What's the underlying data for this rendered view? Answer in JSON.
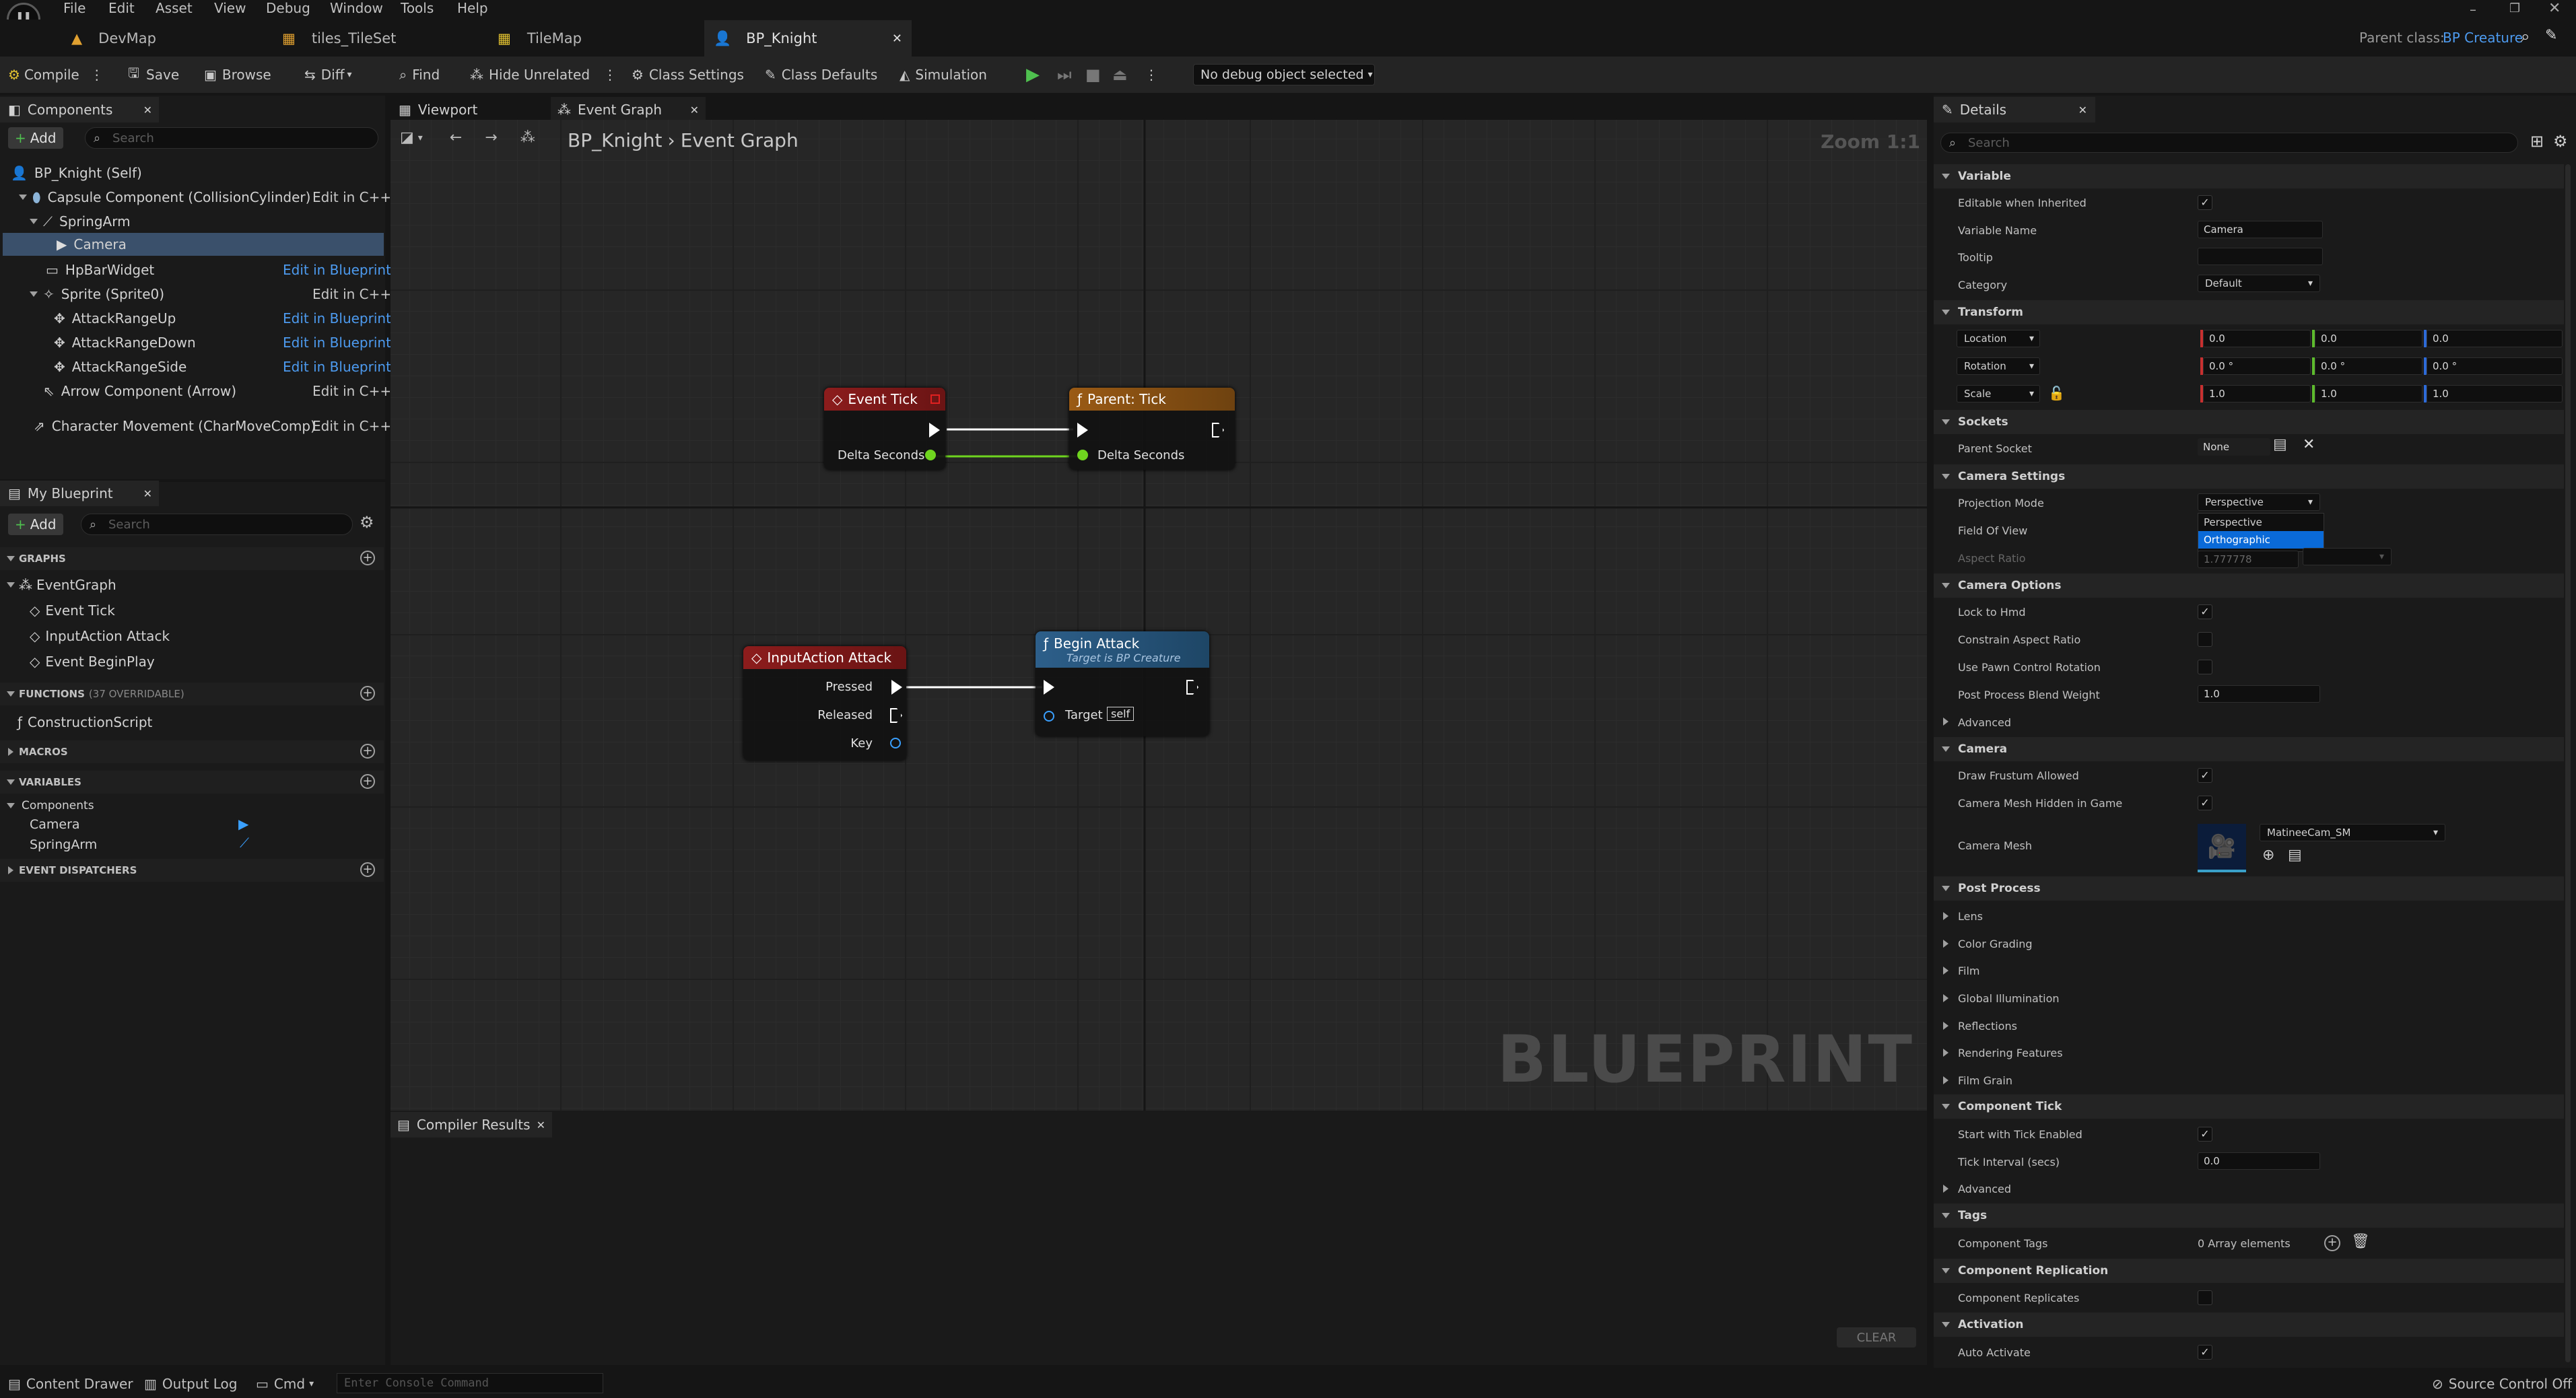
{
  "menu": [
    "File",
    "Edit",
    "Asset",
    "View",
    "Debug",
    "Window",
    "Tools",
    "Help"
  ],
  "logo": "U",
  "tabs": [
    {
      "label": "DevMap"
    },
    {
      "label": "tiles_TileSet"
    },
    {
      "label": "TileMap"
    },
    {
      "label": "BP_Knight"
    }
  ],
  "parent_class": {
    "label": "Parent class:",
    "value": "BP Creature"
  },
  "toolbar": {
    "compile": "Compile",
    "save": "Save",
    "browse": "Browse",
    "diff": "Diff",
    "find": "Find",
    "hide_unrelated": "Hide Unrelated",
    "class_settings": "Class Settings",
    "class_defaults": "Class Defaults",
    "simulation": "Simulation",
    "debug_object": "No debug object selected"
  },
  "components": {
    "tab": "Components",
    "add": "Add",
    "search_placeholder": "Search",
    "items": [
      {
        "label": "BP_Knight (Self)",
        "action": ""
      },
      {
        "label": "Capsule Component (CollisionCylinder)",
        "action": "Edit in C++"
      },
      {
        "label": "SpringArm",
        "action": ""
      },
      {
        "label": "Camera",
        "action": ""
      },
      {
        "label": "HpBarWidget",
        "action": "Edit in Blueprint"
      },
      {
        "label": "Sprite (Sprite0)",
        "action": "Edit in C++"
      },
      {
        "label": "AttackRangeUp",
        "action": "Edit in Blueprint"
      },
      {
        "label": "AttackRangeDown",
        "action": "Edit in Blueprint"
      },
      {
        "label": "AttackRangeSide",
        "action": "Edit in Blueprint"
      },
      {
        "label": "Arrow Component (Arrow)",
        "action": "Edit in C++"
      },
      {
        "label": "Character Movement (CharMoveComp)",
        "action": "Edit in C++"
      }
    ]
  },
  "my_blueprint": {
    "tab": "My Blueprint",
    "add": "Add",
    "search_placeholder": "Search",
    "graphs_header": "GRAPHS",
    "event_graph": "EventGraph",
    "events": [
      "Event Tick",
      "InputAction Attack",
      "Event BeginPlay"
    ],
    "functions_header": "FUNCTIONS",
    "functions_overridable": "(37 OVERRIDABLE)",
    "construction_script": "ConstructionScript",
    "macros_header": "MACROS",
    "variables_header": "VARIABLES",
    "components_category": "Components",
    "variables": [
      "Camera",
      "SpringArm"
    ],
    "dispatchers_header": "EVENT DISPATCHERS"
  },
  "graph": {
    "tabs": [
      "Viewport",
      "Event Graph"
    ],
    "breadcrumb_root": "BP_Knight",
    "breadcrumb_leaf": "Event Graph",
    "zoom": "Zoom 1:1",
    "watermark": "BLUEPRINT",
    "nodes": {
      "event_tick": {
        "title": "Event Tick",
        "pin": "Delta Seconds"
      },
      "parent_tick": {
        "title": "Parent: Tick",
        "pin": "Delta Seconds"
      },
      "input_attack": {
        "title": "InputAction Attack",
        "pins": [
          "Pressed",
          "Released",
          "Key"
        ]
      },
      "begin_attack": {
        "title": "Begin Attack",
        "subtitle": "Target is BP Creature",
        "target_label": "Target",
        "target_value": "self"
      }
    }
  },
  "compiler": {
    "tab": "Compiler Results",
    "clear": "CLEAR"
  },
  "details": {
    "tab": "Details",
    "search_placeholder": "Search",
    "variable": {
      "header": "Variable",
      "editable_when_inherited": "Editable when Inherited",
      "variable_name_label": "Variable Name",
      "variable_name": "Camera",
      "tooltip_label": "Tooltip",
      "category_label": "Category",
      "category": "Default"
    },
    "transform": {
      "header": "Transform",
      "location": "Location",
      "rotation": "Rotation",
      "scale": "Scale",
      "location_values": [
        "0.0",
        "0.0",
        "0.0"
      ],
      "rotation_values": [
        "0.0 °",
        "0.0 °",
        "0.0 °"
      ],
      "scale_values": [
        "1.0",
        "1.0",
        "1.0"
      ]
    },
    "sockets": {
      "header": "Sockets",
      "parent_socket_label": "Parent Socket",
      "parent_socket": "None"
    },
    "camera_settings": {
      "header": "Camera Settings",
      "projection_mode_label": "Projection Mode",
      "projection_mode": "Perspective",
      "options": [
        "Perspective",
        "Orthographic"
      ],
      "fov_label": "Field Of View",
      "aspect_label": "Aspect Ratio",
      "aspect_value": "1.777778"
    },
    "camera_options": {
      "header": "Camera Options",
      "lock_to_hmd": "Lock to Hmd",
      "constrain_aspect": "Constrain Aspect Ratio",
      "use_pawn_control": "Use Pawn Control Rotation",
      "post_process_weight_label": "Post Process Blend Weight",
      "post_process_weight": "1.0",
      "advanced": "Advanced"
    },
    "camera": {
      "header": "Camera",
      "draw_frustum": "Draw Frustum Allowed",
      "mesh_hidden": "Camera Mesh Hidden in Game",
      "camera_mesh_label": "Camera Mesh",
      "camera_mesh": "MatineeCam_SM"
    },
    "post_process": {
      "header": "Post Process",
      "items": [
        "Lens",
        "Color Grading",
        "Film",
        "Global Illumination",
        "Reflections",
        "Rendering Features",
        "Film Grain"
      ]
    },
    "component_tick": {
      "header": "Component Tick",
      "start_with_tick": "Start with Tick Enabled",
      "tick_interval_label": "Tick Interval (secs)",
      "tick_interval": "0.0",
      "advanced": "Advanced"
    },
    "tags": {
      "header": "Tags",
      "component_tags_label": "Component Tags",
      "component_tags": "0 Array elements"
    },
    "replication": {
      "header": "Component Replication",
      "component_replicates": "Component Replicates"
    },
    "activation": {
      "header": "Activation",
      "auto_activate": "Auto Activate"
    }
  },
  "statusbar": {
    "content_drawer": "Content Drawer",
    "output_log": "Output Log",
    "cmd": "Cmd",
    "console_placeholder": "Enter Console Command",
    "source_control": "Source Control Off"
  },
  "colors": {
    "accent": "#4d9bf0",
    "selection": "#3a506b",
    "event_node": "#8c1c1c",
    "function_node": "#9a5a14",
    "call_node": "#2d5f8a",
    "exec_wire": "#ffffff",
    "float_wire": "#6fd51f",
    "play_green": "#4fc04f"
  }
}
